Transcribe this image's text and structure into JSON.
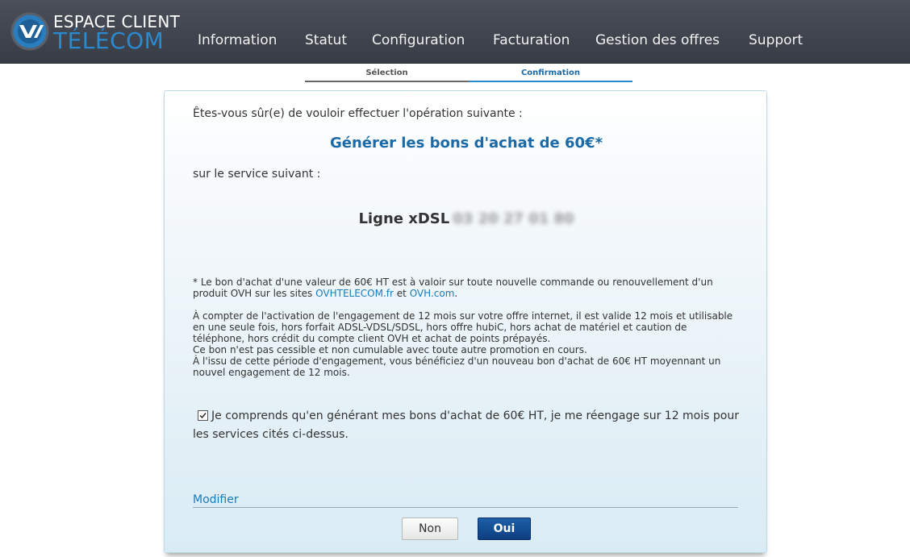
{
  "header": {
    "logo_line1": "ESPACE CLIENT",
    "logo_line2": "TÉLÉCOM",
    "nav": [
      {
        "label": "Information"
      },
      {
        "label": "Statut"
      },
      {
        "label": "Configuration"
      },
      {
        "label": "Facturation"
      },
      {
        "label": "Gestion des offres"
      },
      {
        "label": "Support"
      }
    ]
  },
  "steps": [
    {
      "label": "Sélection",
      "state": "done"
    },
    {
      "label": "Confirmation",
      "state": "active"
    }
  ],
  "panel": {
    "intro": "Êtes-vous sûr(e) de vouloir effectuer l'opération suivante :",
    "operation": "Générer les bons d'achat de 60€*",
    "service_intro": "sur le service suivant :",
    "service_label": "Ligne xDSL",
    "service_number": "03 20 27 01 80",
    "note1_text": "* Le bon d'achat d'une valeur de 60€ HT est à valoir sur toute nouvelle commande ou renouvellement d'un produit OVH sur les sites",
    "note1_link1": "OVHTELECOM.fr",
    "note1_and": "et",
    "note1_link2": "OVH.com",
    "note1_end": ".",
    "note2_lines": [
      "À compter de l'activation de l'engagement de 12 mois sur votre offre internet, il est valide 12 mois et utilisable en une seule fois, hors forfait ADSL-VDSL/SDSL, hors offre hubiC, hors achat de matériel et caution de téléphone, hors crédit du compte client OVH et achat de points prépayés.",
      "Ce bon n'est pas cessible et non cumulable avec toute autre promotion en cours.",
      "À l'issu de cette période d'engagement, vous bénéficiez d'un nouveau bon d'achat de 60€ HT moyennant un nouvel engagement de 12 mois."
    ],
    "confirm_text": "Je comprends qu'en générant mes bons d'achat de 60€ HT, je me réengage sur 12 mois pour les services cités ci-dessus.",
    "confirm_checked": true,
    "modifier": "Modifier",
    "btn_no": "Non",
    "btn_yes": "Oui"
  },
  "colors": {
    "accent": "#1a6aa8",
    "header_bg": "#3f434c",
    "primary_button": "#0d3f80"
  }
}
